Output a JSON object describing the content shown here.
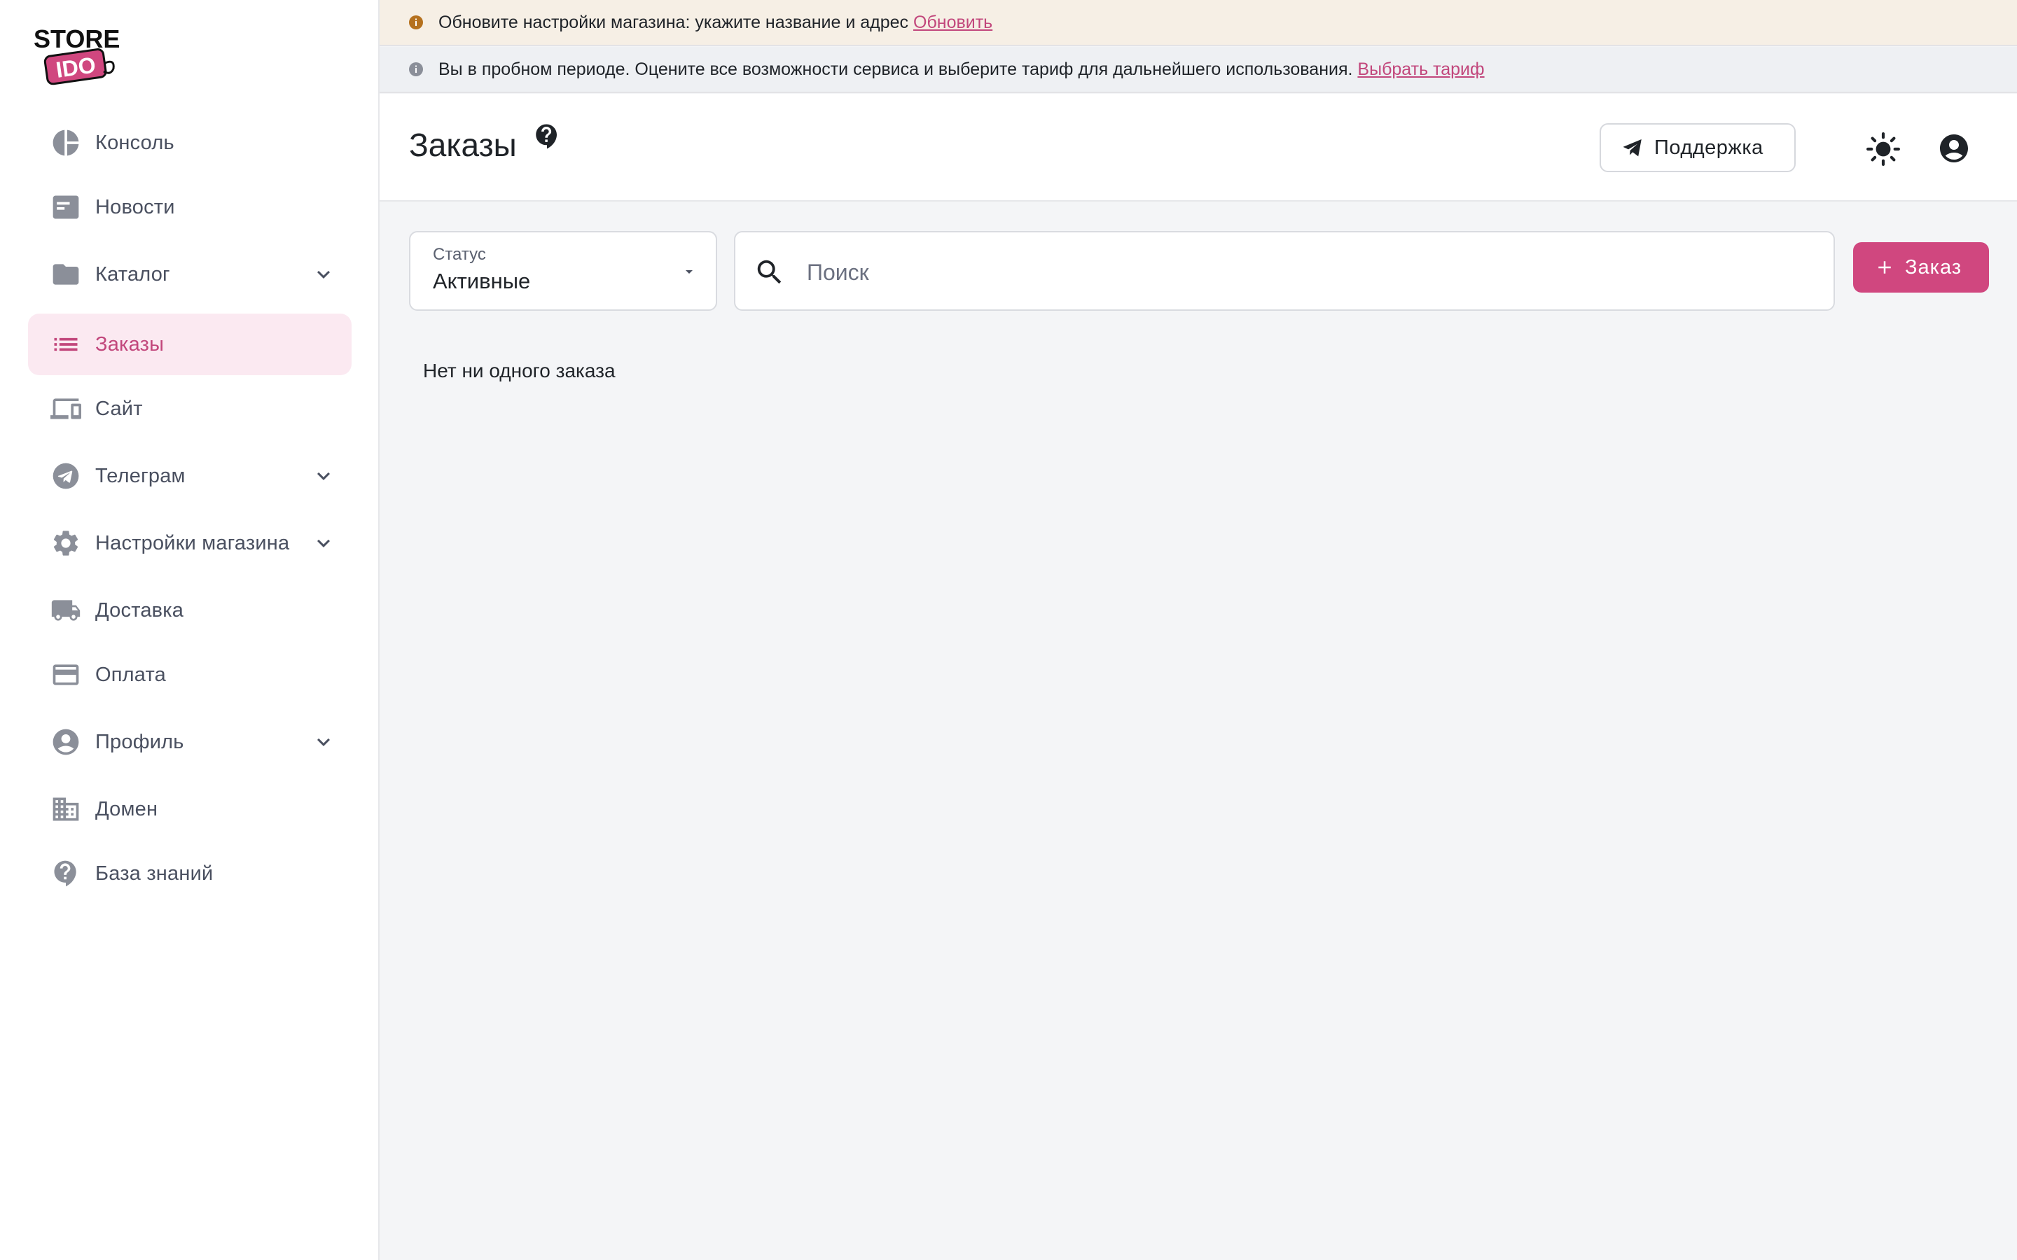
{
  "brand": {
    "logo_top": "STORE",
    "logo_bottom": "IDO",
    "accent": "#d0477f"
  },
  "sidebar": {
    "items": [
      {
        "label": "Консоль",
        "icon": "pie-chart-icon",
        "expandable": false,
        "active": false
      },
      {
        "label": "Новости",
        "icon": "news-icon",
        "expandable": false,
        "active": false
      },
      {
        "label": "Каталог",
        "icon": "folder-icon",
        "expandable": true,
        "active": false
      },
      {
        "label": "Заказы",
        "icon": "list-icon",
        "expandable": false,
        "active": true
      },
      {
        "label": "Сайт",
        "icon": "devices-icon",
        "expandable": false,
        "active": false
      },
      {
        "label": "Телеграм",
        "icon": "telegram-icon",
        "expandable": true,
        "active": false
      },
      {
        "label": "Настройки магазина",
        "icon": "gear-icon",
        "expandable": true,
        "active": false
      },
      {
        "label": "Доставка",
        "icon": "truck-icon",
        "expandable": false,
        "active": false
      },
      {
        "label": "Оплата",
        "icon": "credit-card-icon",
        "expandable": false,
        "active": false
      },
      {
        "label": "Профиль",
        "icon": "user-circle-icon",
        "expandable": true,
        "active": false
      },
      {
        "label": "Домен",
        "icon": "building-icon",
        "expandable": false,
        "active": false
      },
      {
        "label": "База знаний",
        "icon": "help-circle-icon",
        "expandable": false,
        "active": false
      }
    ]
  },
  "banners": {
    "settings": {
      "text": "Обновите настройки магазина: укажите название и адрес",
      "link": "Обновить",
      "color": "#b5711e"
    },
    "trial": {
      "text": "Вы в пробном периоде. Оцените все возможности сервиса и выберите тариф для дальнейшего использования.",
      "link": "Выбрать тариф",
      "color": "#8b8f99"
    }
  },
  "header": {
    "title": "Заказы",
    "support_label": "Поддержка"
  },
  "filters": {
    "status_label": "Статус",
    "status_value": "Активные",
    "search_placeholder": "Поиск",
    "search_value": ""
  },
  "actions": {
    "add_order_label": "Заказ"
  },
  "content": {
    "empty_message": "Нет ни одного заказа"
  }
}
